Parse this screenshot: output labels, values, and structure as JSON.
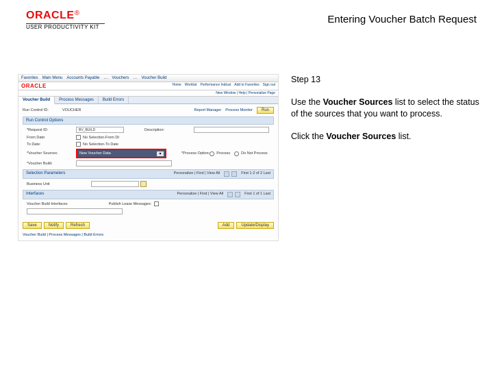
{
  "header": {
    "logo_text": "ORACLE",
    "logo_sub": "USER PRODUCTIVITY KIT",
    "title": "Entering Voucher Batch Request"
  },
  "instructions": {
    "step_label": "Step 13",
    "para1_a": "Use the ",
    "para1_bold": "Voucher Sources",
    "para1_b": " list to select the status of the sources that you want to process.",
    "para2_a": "Click the ",
    "para2_bold": "Voucher Sources",
    "para2_b": " list."
  },
  "screenshot": {
    "breadcrumb": [
      "Favorites",
      "Main Menu",
      "Accounts Payable",
      "…",
      "Vouchers",
      "…",
      "Voucher Build"
    ],
    "oracle_logo": "ORACLE",
    "oracle_links": [
      "Home",
      "Worklist",
      "Performance Indicat",
      "Add to Favorites",
      "Sign out"
    ],
    "subbar": "New Window | Help | Personalize Page",
    "tabs": [
      "Voucher Build",
      "Process Messages",
      "Build Errors"
    ],
    "run": {
      "label": "Run Control ID:",
      "value": "VOUCHER",
      "report_mgr": "Report Manager",
      "process_mon": "Process Monitor",
      "run_btn": "Run"
    },
    "section_options": "Run Control Options",
    "form": {
      "request_id": {
        "label": "*Request ID:",
        "value": "BV_BUILD"
      },
      "description": {
        "label": "Description:"
      },
      "from_date": {
        "label": "From Date:",
        "option": "No Selection-From Dt"
      },
      "to_date": {
        "label": "To Date:",
        "option": "No Selection-To Date"
      },
      "voucher_sources": {
        "label": "*Voucher Sources:",
        "value": "New Voucher Data"
      },
      "voucher_build": {
        "label": "*Voucher Build:"
      },
      "process_option": {
        "label": "*Process Option:",
        "radio1": "Process",
        "radio2": "Do Not Process"
      }
    },
    "grid1": {
      "title": "Selection Parameters",
      "meta": "Personalize | Find | View All",
      "nav": "First 1-2 of 2 Last"
    },
    "row_label1": "Business Unit",
    "grid2": {
      "title": "Interfaces",
      "meta": "Personalize | Find | View All",
      "nav": "First 1 of 1 Last"
    },
    "row_label2": "Voucher Build Interfaces",
    "pub_label": "Publish Lease Messages:",
    "footer": {
      "save": "Save",
      "notify": "Notify",
      "refresh": "Refresh",
      "add": "Add",
      "update": "Update/Display",
      "breadcrumb": "Voucher Build | Process Messages | Build Errors"
    }
  }
}
